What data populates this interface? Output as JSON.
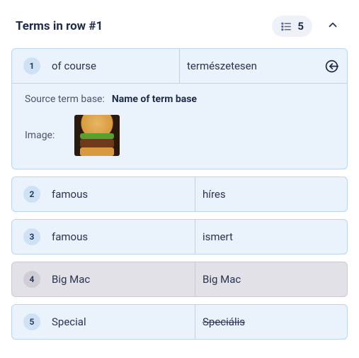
{
  "header": {
    "title": "Terms in row #1",
    "count": "5"
  },
  "terms": [
    {
      "num": "1",
      "source": "of course",
      "target": "természetesen",
      "hasInsert": true,
      "expanded": true,
      "struck": false,
      "variant": "normal"
    },
    {
      "num": "2",
      "source": "famous",
      "target": "híres",
      "hasInsert": false,
      "expanded": false,
      "struck": false,
      "variant": "normal"
    },
    {
      "num": "3",
      "source": "famous",
      "target": "ismert",
      "hasInsert": false,
      "expanded": false,
      "struck": false,
      "variant": "normal"
    },
    {
      "num": "4",
      "source": "Big Mac",
      "target": "Big Mac",
      "hasInsert": false,
      "expanded": false,
      "struck": false,
      "variant": "forbidden"
    },
    {
      "num": "5",
      "source": "Special",
      "target": "Speciális",
      "hasInsert": false,
      "expanded": false,
      "struck": true,
      "variant": "normal"
    }
  ],
  "details": {
    "sourceLabel": "Source term base:",
    "sourceValue": "Name of term base",
    "imageLabel": "Image:"
  }
}
